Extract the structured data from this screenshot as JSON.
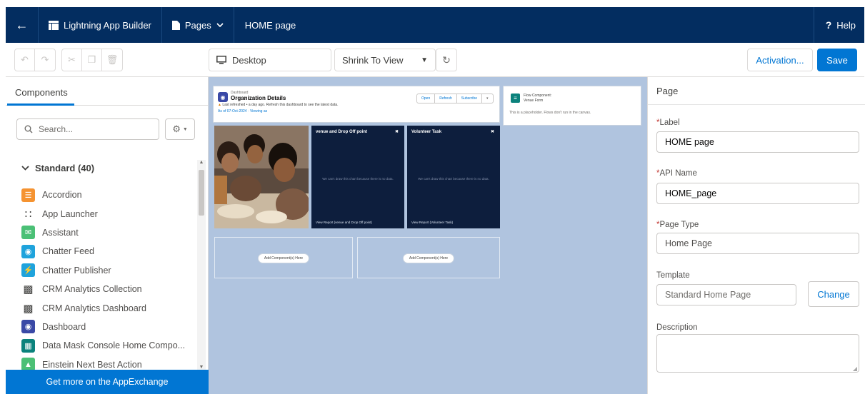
{
  "header": {
    "app_title": "Lightning App Builder",
    "pages_label": "Pages",
    "page_name": "HOME page",
    "help_label": "Help"
  },
  "toolbar": {
    "device": "Desktop",
    "zoom": "Shrink To View",
    "activation_label": "Activation...",
    "save_label": "Save"
  },
  "left_panel": {
    "tab_label": "Components",
    "search_placeholder": "Search...",
    "section_title": "Standard (40)",
    "items": [
      {
        "label": "Accordion",
        "icon": "accordion-icon",
        "color": "#f59331"
      },
      {
        "label": "App Launcher",
        "icon": "app-launcher-icon",
        "color": "#3e3e3c"
      },
      {
        "label": "Assistant",
        "icon": "assistant-icon",
        "color": "#4bc076"
      },
      {
        "label": "Chatter Feed",
        "icon": "chatter-feed-icon",
        "color": "#1fa3dc"
      },
      {
        "label": "Chatter Publisher",
        "icon": "chatter-publisher-icon",
        "color": "#1fa3dc"
      },
      {
        "label": "CRM Analytics Collection",
        "icon": "analytics-collection-icon",
        "color": "#3e3e3c"
      },
      {
        "label": "CRM Analytics Dashboard",
        "icon": "analytics-dashboard-icon",
        "color": "#3e3e3c"
      },
      {
        "label": "Dashboard",
        "icon": "dashboard-icon",
        "color": "#3a49a6"
      },
      {
        "label": "Data Mask Console Home Compo...",
        "icon": "data-mask-icon",
        "color": "#0b827c"
      },
      {
        "label": "Einstein Next Best Action",
        "icon": "einstein-icon",
        "color": "#4bc076"
      }
    ],
    "appexchange_label": "Get more on the AppExchange"
  },
  "canvas": {
    "dashboard": {
      "small_label": "Dashboard",
      "title": "Organization Details",
      "warning": "Last refreshed • a day ago. Refresh this dashboard to see the latest data.",
      "as_of": "As of 07-Oct-2024 · Viewing as",
      "buttons": [
        "Open",
        "Refresh",
        "Subscribe",
        "▾"
      ]
    },
    "flow": {
      "title": "Flow Component:",
      "subtitle": "Venue Form",
      "note": "This is a placeholder. Flows don't run in the canvas."
    },
    "chart_cards": [
      {
        "title": "venue and Drop Off point",
        "message": "We can't draw this chart because there is no data.",
        "footer": "View Report (venue and Drop Off point)"
      },
      {
        "title": "Volunteer Task",
        "message": "We can't draw this chart because there is no data.",
        "footer": "View Report (Volunteer Task)"
      }
    ],
    "dropzone_label": "Add Component(s) Here"
  },
  "right_panel": {
    "title": "Page",
    "label_field": {
      "label": "Label",
      "value": "HOME page"
    },
    "api_field": {
      "label": "API Name",
      "value": "HOME_page"
    },
    "type_field": {
      "label": "Page Type",
      "value": "Home Page"
    },
    "template_field": {
      "label": "Template",
      "value": "Standard Home Page",
      "button": "Change"
    },
    "description_field": {
      "label": "Description"
    }
  },
  "colors": {
    "header_bg": "#032d60",
    "brand_blue": "#0176d3",
    "canvas_bg": "#b0c4df",
    "card_dark": "#0d1e3d"
  }
}
